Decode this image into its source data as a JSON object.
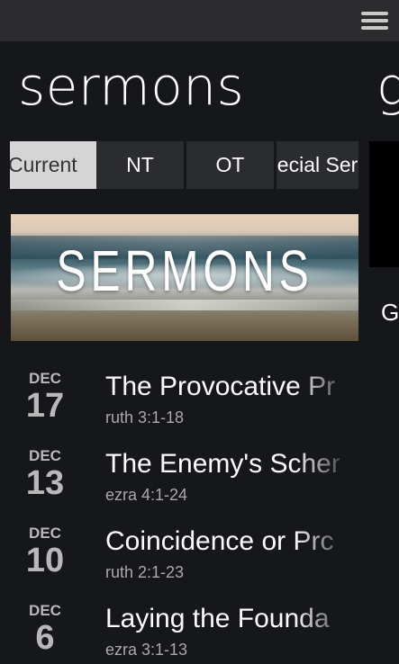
{
  "header": {
    "menu_icon": "hamburger-menu-icon"
  },
  "page": {
    "title": "sermons",
    "next_pivot_title": "g",
    "side_letter": "G"
  },
  "tabs": [
    {
      "label": "Current",
      "active": true
    },
    {
      "label": "NT",
      "active": false
    },
    {
      "label": "OT",
      "active": false
    },
    {
      "label": "pecial Ser",
      "active": false
    }
  ],
  "banner": {
    "text": "SERMONS"
  },
  "sermons": [
    {
      "month": "DEC",
      "day": "17",
      "title": "The Provocative Pr",
      "reference": "ruth 3:1-18"
    },
    {
      "month": "DEC",
      "day": "13",
      "title": "The Enemy's Schen",
      "reference": "ezra 4:1-24"
    },
    {
      "month": "DEC",
      "day": "10",
      "title": "Coincidence or Prc",
      "reference": "ruth 2:1-23"
    },
    {
      "month": "DEC",
      "day": "6",
      "title": "Laying the Founda",
      "reference": "ezra 3:1-13"
    }
  ],
  "colors": {
    "background": "#16171b",
    "topbar": "#2c2c2e",
    "tab_active": "#d5d5d5",
    "tab_inactive": "#2b2c30",
    "date_text": "#b8b8b8",
    "reference_text": "#a9a9a9"
  }
}
